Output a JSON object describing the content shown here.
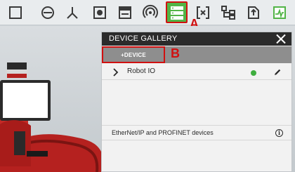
{
  "toolbar": {
    "icons": [
      "square-icon",
      "circle-minus-icon",
      "tripod-icon",
      "camera-frame-icon",
      "window-icon",
      "signal-icon",
      "device-list-icon",
      "bracket-x-icon",
      "tree-icon",
      "export-icon",
      "chart-icon"
    ],
    "active": "device-list-icon",
    "accent": "#52b447"
  },
  "annotations": {
    "a": "A",
    "b": "B",
    "color": "#d01010"
  },
  "panel": {
    "title": "DEVICE GALLERY",
    "add_device_label": "+DEVICE",
    "devices": [
      {
        "name": "Robot IO",
        "status_color": "#3fae3f"
      }
    ],
    "footer_text": "EtherNet/IP and PROFINET devices",
    "footer_icon": "info-icon"
  }
}
